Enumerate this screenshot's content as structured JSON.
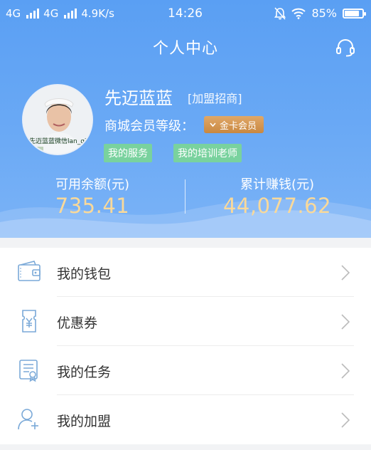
{
  "status_bar": {
    "network1": "4G",
    "network2": "4G",
    "speed": "4.9K/s",
    "time": "14:26",
    "battery": "85%",
    "battery_level": 0.85
  },
  "header": {
    "title": "个人中心",
    "support_icon": "headset-icon"
  },
  "profile": {
    "avatar_caption": "先迈蓝蓝微信lan_qiu",
    "name": "先迈蓝蓝",
    "join_link": "[加盟招商]",
    "level_label": "商城会员等级：",
    "level_badge": "金卡会员",
    "tags": [
      "我的服务",
      "我的培训老师"
    ]
  },
  "balances": {
    "available_label": "可用余额(元)",
    "available_value": "735.41",
    "earned_label": "累计赚钱(元)",
    "earned_value": "44,077.62"
  },
  "menu": [
    {
      "label": "我的钱包",
      "icon": "wallet-icon"
    },
    {
      "label": "优惠券",
      "icon": "coupon-icon"
    },
    {
      "label": "我的任务",
      "icon": "task-icon"
    },
    {
      "label": "我的加盟",
      "icon": "add-user-icon"
    }
  ],
  "colors": {
    "header_blue": "#5a9ff3",
    "balance_gold": "#f9d99a",
    "tag_green": "#79d29e",
    "badge_gold": "#d49a54"
  }
}
